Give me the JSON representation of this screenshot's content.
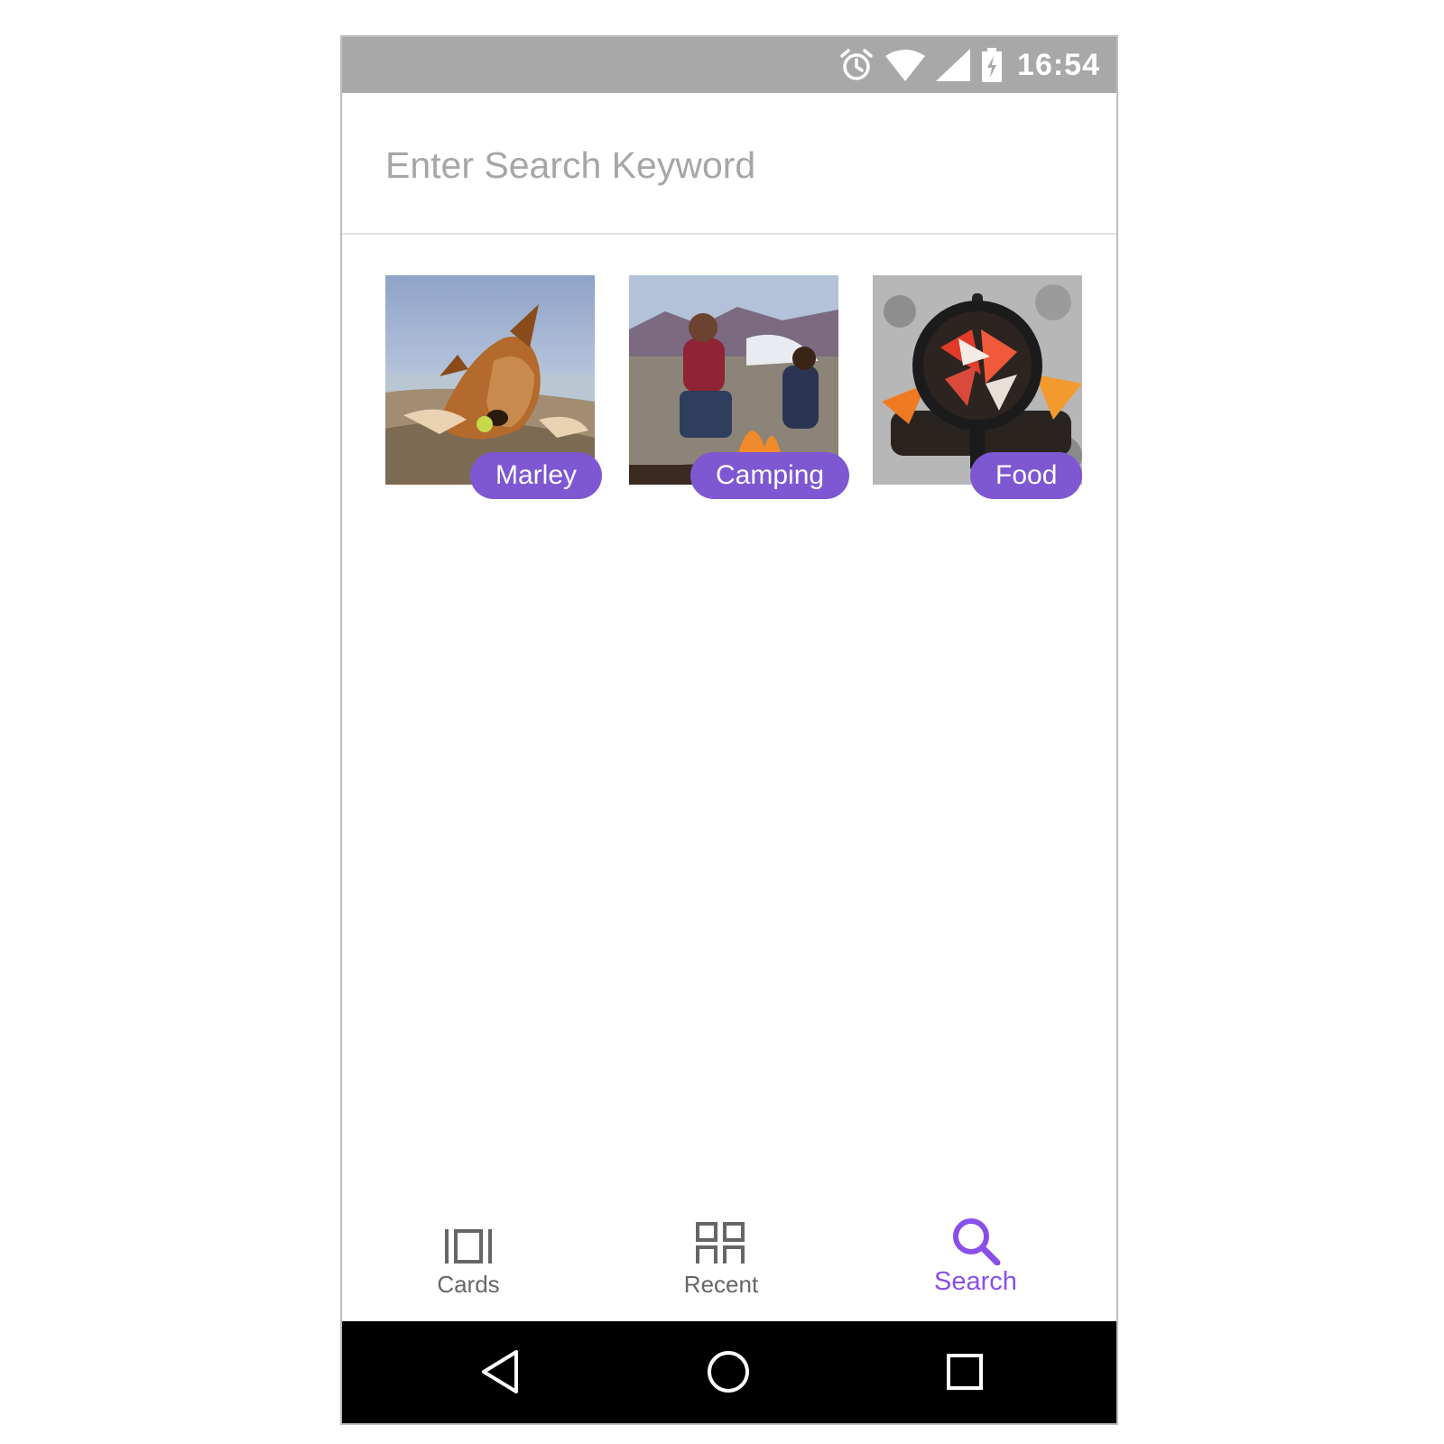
{
  "status_bar": {
    "time": "16:54",
    "icons": [
      "alarm-icon",
      "wifi-icon",
      "signal-icon",
      "battery-charging-icon"
    ],
    "background": "#a8a8a8"
  },
  "search": {
    "placeholder": "Enter Search Keyword",
    "value": ""
  },
  "tiles": [
    {
      "label": "Marley",
      "image": "dog-on-beach-photo"
    },
    {
      "label": "Camping",
      "image": "campfire-people-photo"
    },
    {
      "label": "Food",
      "image": "skillet-on-fire-photo"
    }
  ],
  "bottom_nav": {
    "items": [
      {
        "label": "Cards",
        "icon": "cards-icon",
        "active": false
      },
      {
        "label": "Recent",
        "icon": "grid-icon",
        "active": false
      },
      {
        "label": "Search",
        "icon": "search-icon",
        "active": true
      }
    ]
  },
  "system_nav": {
    "icons": [
      "back-icon",
      "home-icon",
      "overview-icon"
    ]
  },
  "colors": {
    "accent": "#7e57d2",
    "active_nav": "#8a4fe8",
    "inactive_nav": "#666666",
    "placeholder": "#a6a6a6"
  }
}
